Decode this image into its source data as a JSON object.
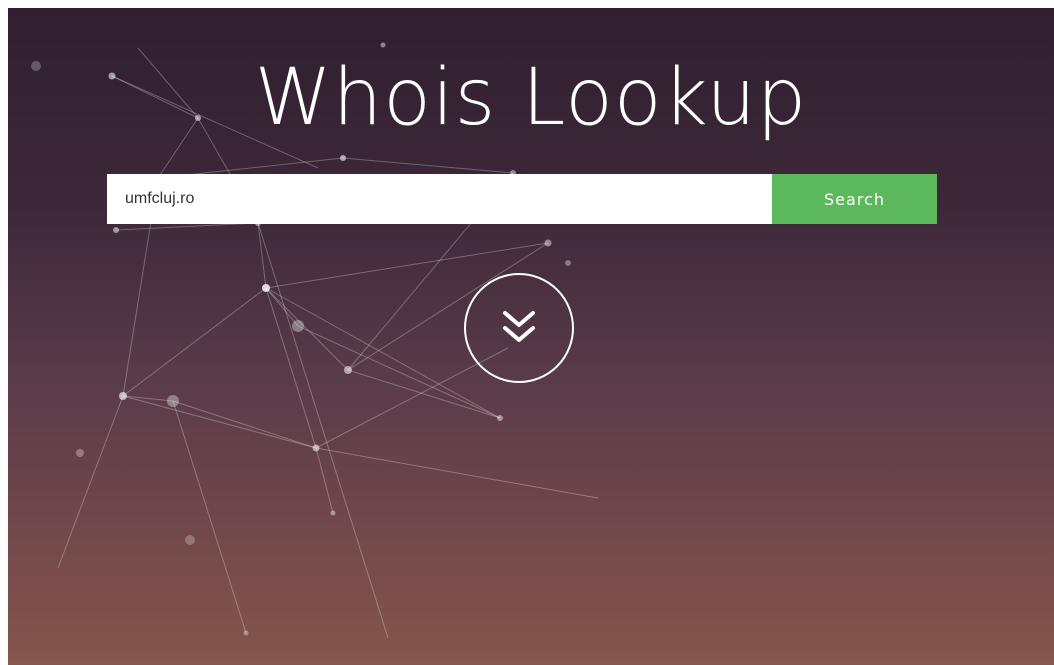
{
  "hero": {
    "title": "Whois Lookup"
  },
  "search": {
    "value": "umfcluj.ro",
    "button_label": "Search"
  },
  "scroll": {
    "icon": "double-chevron-down-icon"
  },
  "colors": {
    "button_green": "#5cb85c",
    "background_top": "#2f1f2f",
    "background_bottom": "#85564c"
  }
}
